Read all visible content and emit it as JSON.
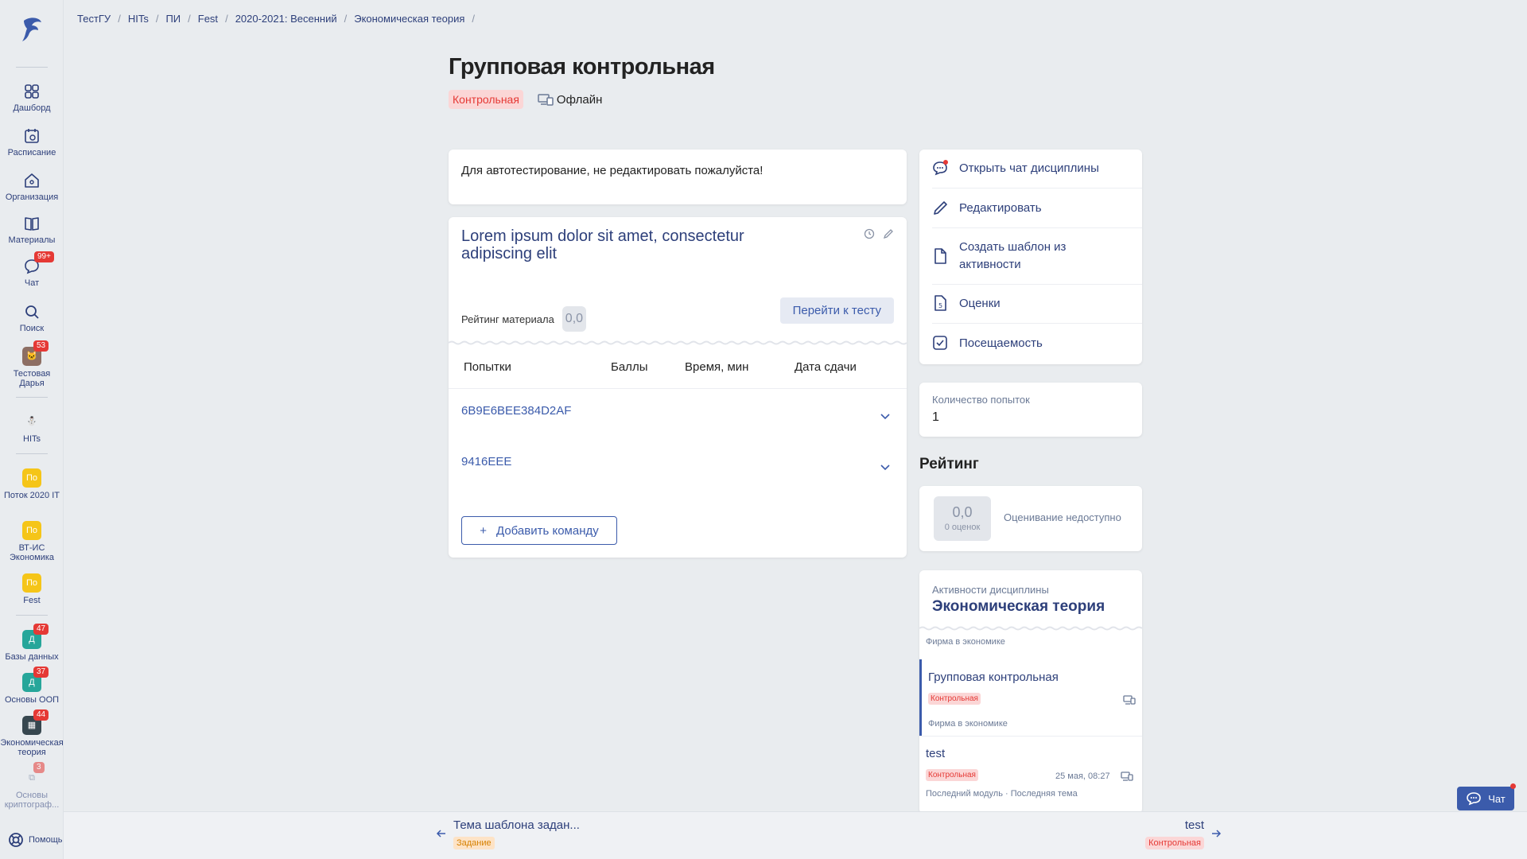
{
  "breadcrumbs": [
    "ТестГУ",
    "HITs",
    "ПИ",
    "Fest",
    "2020-2021: Весенний",
    "Экономическая теория"
  ],
  "sidebar": {
    "items": [
      {
        "label": "Дашборд"
      },
      {
        "label": "Расписание"
      },
      {
        "label": "Организация"
      },
      {
        "label": "Материалы"
      },
      {
        "label": "Чат",
        "badge": "99+"
      },
      {
        "label": "Поиск"
      },
      {
        "label": "Тестовая Дарья",
        "badge": "53"
      },
      {
        "label": "HITs"
      },
      {
        "label": "Поток 2020 IT",
        "avatar": "По"
      },
      {
        "label": "ВТ-ИС Экономика",
        "avatar": "По"
      },
      {
        "label": "Fest",
        "avatar": "По"
      },
      {
        "label": "Базы данных",
        "avatar": "Д",
        "badge": "47"
      },
      {
        "label": "Основы ООП",
        "avatar": "Д",
        "badge": "37"
      },
      {
        "label": "Экономическая теория",
        "badge": "44"
      },
      {
        "label": "Основы криптограф...",
        "badge": "3"
      }
    ],
    "help_label": "Помощь"
  },
  "page": {
    "title": "Групповая контрольная",
    "type_tag": "Контрольная",
    "mode": "Офлайн",
    "note": "Для автотестирование, не редактировать пожалуйста!"
  },
  "material": {
    "title": "Lorem ipsum dolor sit amet, consectetur adipiscing elit",
    "rating_label": "Рейтинг материала",
    "rating_value": "0,0",
    "go_button": "Перейти к тесту",
    "columns": [
      "Попытки",
      "Баллы",
      "Время, мин",
      "Дата сдачи"
    ],
    "teams": [
      "6B9E6BEE384D2AF",
      "9416EEE"
    ],
    "add_team": "Добавить команду"
  },
  "menu": {
    "items": [
      "Открыть чат дисциплины",
      "Редактировать",
      "Создать шаблон из активности",
      "Оценки",
      "Посещаемость"
    ]
  },
  "attempts": {
    "label": "Количество попыток",
    "value": "1"
  },
  "rating": {
    "heading": "Рейтинг",
    "value": "0,0",
    "count": "0 оценок",
    "status": "Оценивание недоступно"
  },
  "activities": {
    "label": "Активности дисциплины",
    "heading": "Экономическая теория",
    "items": [
      {
        "subtitle": "Фирма в экономике"
      },
      {
        "title": "Групповая контрольная",
        "tag": "Контрольная",
        "subtitle": "Фирма в экономике"
      },
      {
        "title": "test",
        "tag": "Контрольная",
        "date": "25 мая, 08:27",
        "subtitle": "Последний модуль · Последняя тема"
      }
    ]
  },
  "bottom": {
    "prev_title": "Тема шаблона задан...",
    "prev_tag": "Задание",
    "next_title": "test",
    "next_tag": "Контрольная"
  },
  "chat_button": "Чат",
  "colors": {
    "accent": "#3b5bab",
    "danger": "#e53935",
    "background": "#e9ecef"
  }
}
